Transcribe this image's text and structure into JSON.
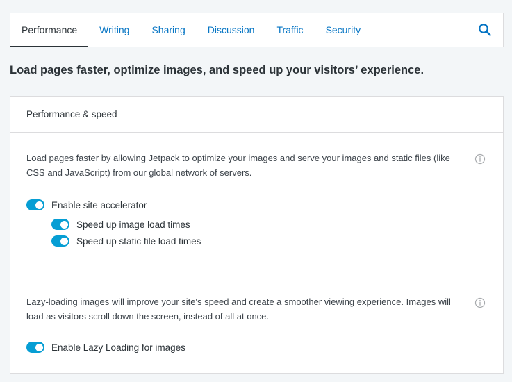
{
  "tabs": [
    {
      "label": "Performance",
      "active": true
    },
    {
      "label": "Writing",
      "active": false
    },
    {
      "label": "Sharing",
      "active": false
    },
    {
      "label": "Discussion",
      "active": false
    },
    {
      "label": "Traffic",
      "active": false
    },
    {
      "label": "Security",
      "active": false
    }
  ],
  "search": {
    "icon": "search-icon"
  },
  "headline": "Load pages faster, optimize images, and speed up your visitors’ experience.",
  "card": {
    "title": "Performance & speed",
    "sections": [
      {
        "description": "Load pages faster by allowing Jetpack to optimize your images and serve your images and static files (like CSS and JavaScript) from our global network of servers.",
        "toggles": [
          {
            "label": "Enable site accelerator",
            "on": true
          },
          {
            "label": "Speed up image load times",
            "on": true
          },
          {
            "label": "Speed up static file load times",
            "on": true
          }
        ]
      },
      {
        "description": "Lazy-loading images will improve your site's speed and create a smoother viewing experience. Images will load as visitors scroll down the screen, instead of all at once.",
        "toggles": [
          {
            "label": "Enable Lazy Loading for images",
            "on": true
          }
        ]
      }
    ]
  },
  "colors": {
    "accent": "#0675c4",
    "toggle": "#069ed4",
    "text": "#2c3338"
  }
}
